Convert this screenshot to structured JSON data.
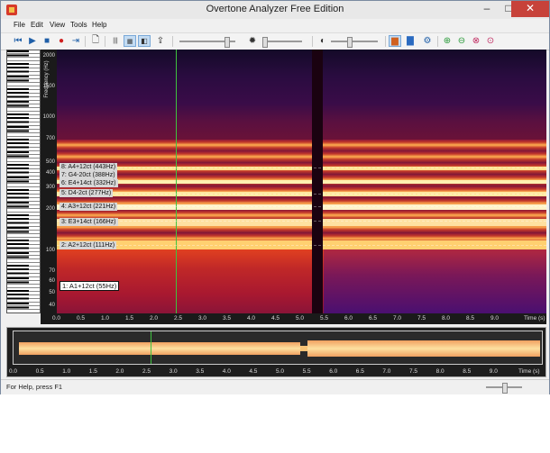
{
  "window": {
    "title": "Overtone Analyzer Free Edition",
    "minimize": "–",
    "maximize": "□",
    "close": "✕"
  },
  "menu": [
    "File",
    "Edit",
    "View",
    "Tools",
    "Help"
  ],
  "toolbar": {
    "buttons": [
      "skip-back",
      "play",
      "stop",
      "record",
      "repeat",
      "new-document",
      "view-piano",
      "view-linear",
      "view-split",
      "export",
      "settings",
      "contrast",
      "spectrum-color",
      "spectrum-mode",
      "gear",
      "zoom-in",
      "zoom-out",
      "zoom-reset",
      "zoom-fit"
    ],
    "accent": "#79a8d8"
  },
  "spectrogram": {
    "y_title": "Frequency (Hz)",
    "y_ticks": [
      "2000",
      "1500",
      "1000",
      "700",
      "500",
      "400",
      "300",
      "200",
      "100",
      "70",
      "60",
      "50",
      "40"
    ],
    "x_title": "Time (s)",
    "x_ticks": [
      "0.0",
      "0.5",
      "1.0",
      "1.5",
      "2.0",
      "2.5",
      "3.0",
      "3.5",
      "4.0",
      "4.5",
      "5.0",
      "5.5",
      "6.0",
      "6.5",
      "7.0",
      "7.5",
      "8.0",
      "8.5",
      "9.0"
    ],
    "notes": [
      {
        "label": "8: A4+12ct (443Hz)"
      },
      {
        "label": "7: G4-20ct (388Hz)"
      },
      {
        "label": "6: E4+14ct (332Hz)"
      },
      {
        "label": "5: D4-2ct (277Hz)"
      },
      {
        "label": "4: A3+12ct (221Hz)"
      },
      {
        "label": "3: E3+14ct (166Hz)"
      },
      {
        "label": "2: A2+12ct (111Hz)"
      },
      {
        "label": "1: A1+12ct (55Hz)",
        "selected": true
      }
    ],
    "cursor_time": 2.5,
    "cursor_color": "#3fc23f"
  },
  "waveform": {
    "x_ticks": [
      "0.0",
      "0.5",
      "1.0",
      "1.5",
      "2.0",
      "2.5",
      "3.0",
      "3.5",
      "4.0",
      "4.5",
      "5.0",
      "5.5",
      "6.0",
      "6.5",
      "7.0",
      "7.5",
      "8.0",
      "8.5",
      "9.0"
    ],
    "x_title": "Time (s)",
    "cursor_time": 2.5
  },
  "status": {
    "text": "For Help, press F1"
  }
}
